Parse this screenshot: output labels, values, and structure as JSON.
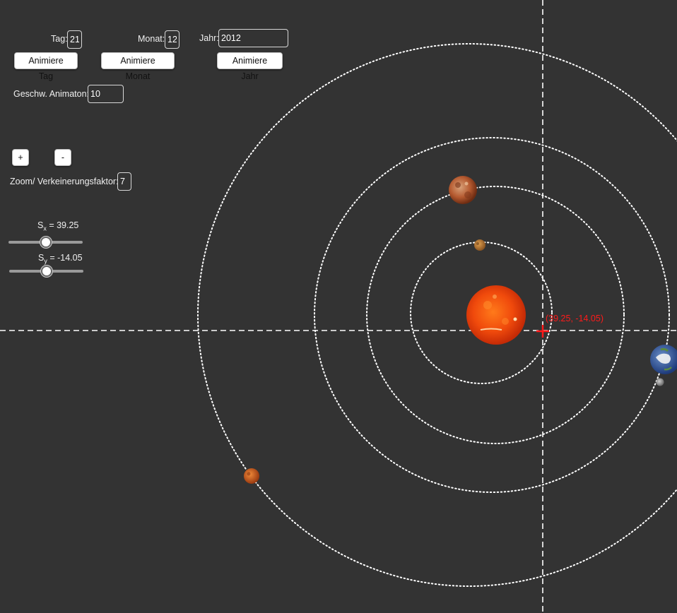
{
  "date": {
    "day_label": "Tag:",
    "day_value": "21",
    "month_label": "Monat:",
    "month_value": "12",
    "year_label": "Jahr:",
    "year_value": "2012"
  },
  "buttons": {
    "animate_day": "Animiere Tag",
    "animate_month": "Animiere Monat",
    "animate_year": "Animiere Jahr",
    "zoom_in": "+",
    "zoom_out": "-"
  },
  "speed": {
    "label": "Geschw. Animaton:",
    "value": "10"
  },
  "zoom": {
    "label": "Zoom/ Verkeinerungsfaktor:",
    "value": "7"
  },
  "sliders": {
    "sx": {
      "symbol": "S",
      "sub": "x",
      "text": " = 39.25",
      "value": 39.25
    },
    "sy": {
      "symbol": "S",
      "sub": "y",
      "text": " = -14.05",
      "value": -14.05
    }
  },
  "point_label": "(39.25, -14.05)",
  "colors": {
    "background": "#333333",
    "orbit": "#ffffff",
    "crosshair": "#ff1a1a",
    "sun": "#e8400a"
  },
  "bodies": [
    "sun",
    "mercury",
    "venus",
    "earth",
    "moon",
    "mars"
  ]
}
